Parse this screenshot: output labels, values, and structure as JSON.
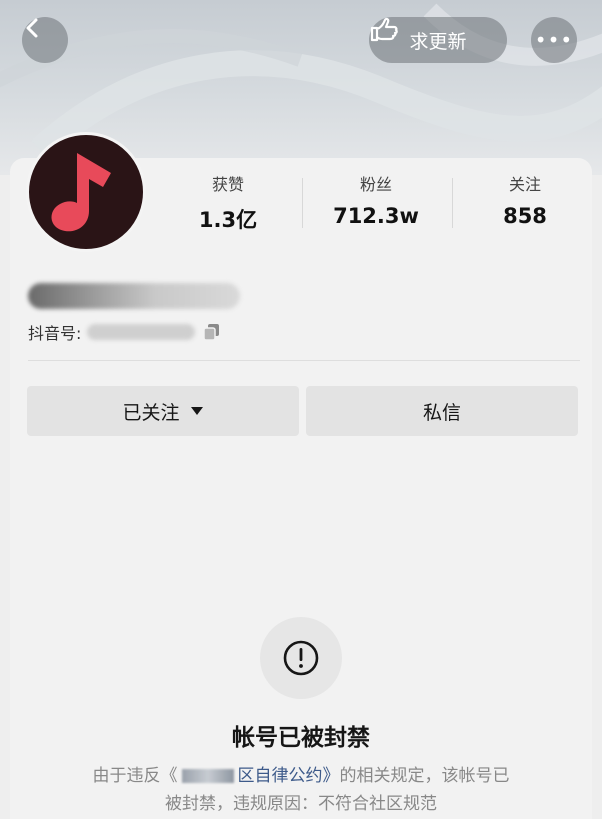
{
  "header": {
    "back_icon": "chevron-left-icon",
    "update_button_label": "求更新",
    "update_icon": "pointing-hand-icon",
    "more_icon": "more-dots-icon",
    "more_glyph": "•••"
  },
  "profile": {
    "avatar_icon": "music-note-icon",
    "avatar_color": "#e84a5a",
    "stats": [
      {
        "label": "获赞",
        "value": "1.3亿"
      },
      {
        "label": "粉丝",
        "value": "712.3w"
      },
      {
        "label": "关注",
        "value": "858"
      }
    ],
    "id_label": "抖音号:",
    "copy_icon": "copy-icon"
  },
  "actions": {
    "followed_label": "已关注",
    "followed_icon": "caret-down-icon",
    "message_label": "私信"
  },
  "notice": {
    "icon": "exclamation-circle-icon",
    "title": "帐号已被封禁",
    "line1_prefix": "由于违反《",
    "line1_link": "区自律公约》",
    "line1_suffix": "的相关规定，该帐号已",
    "line2": "被封禁，违规原因：不符合社区规范"
  }
}
